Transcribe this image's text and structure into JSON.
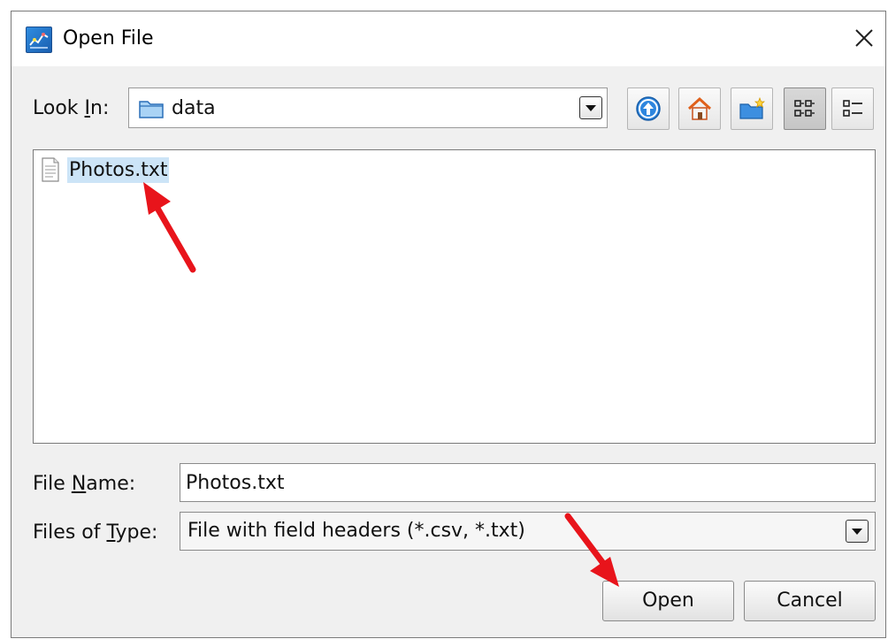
{
  "window": {
    "title": "Open File",
    "app_icon": "app-chart-icon",
    "close_icon": "close-icon"
  },
  "look_in": {
    "label_before": "Look ",
    "label_mnemonic": "I",
    "label_after": "n:",
    "value": "data",
    "icon": "folder-icon"
  },
  "toolbar": {
    "buttons": [
      {
        "name": "up-one-level-button",
        "icon": "up-arrow-icon"
      },
      {
        "name": "home-button",
        "icon": "home-icon"
      },
      {
        "name": "new-folder-button",
        "icon": "new-folder-icon"
      },
      {
        "name": "list-view-button",
        "icon": "list-view-icon",
        "pressed": true
      },
      {
        "name": "details-view-button",
        "icon": "details-view-icon",
        "pressed": false
      }
    ]
  },
  "files": [
    {
      "name": "Photos.txt",
      "icon": "document-icon",
      "selected": true
    }
  ],
  "file_name": {
    "label_before": "File ",
    "label_mnemonic": "N",
    "label_after": "ame:",
    "value": "Photos.txt"
  },
  "file_type": {
    "label_before": "Files of ",
    "label_mnemonic": "T",
    "label_after": "ype:",
    "value": "File with field headers (*.csv, *.txt)"
  },
  "buttons": {
    "open": "Open",
    "cancel": "Cancel"
  },
  "colors": {
    "selection": "#cce4f7",
    "annotation_arrow": "#e8141b",
    "dialog_bg": "#f0f0f0"
  }
}
